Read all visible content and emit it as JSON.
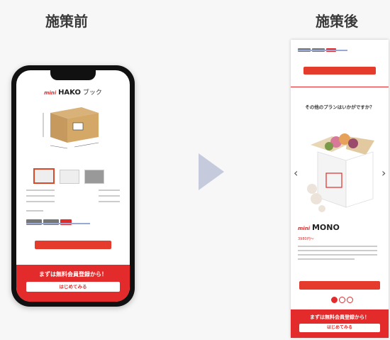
{
  "labels": {
    "before": "施策前",
    "after": "施策後"
  },
  "left_phone": {
    "brand_logo": "mini",
    "brand_sub": "HAKO",
    "brand_suffix": "ブック",
    "banner_text": "まずは無料会員登録から！",
    "banner_button": "はじめてみる"
  },
  "right_screen": {
    "question": "その他のプランはいかがですか？",
    "product_logo": "mini",
    "product_name": "MONO",
    "price": "3980円～",
    "banner_text": "まずは無料会員登録から！",
    "banner_button": "はじめてみる"
  },
  "colors": {
    "accent": "#e32b2b",
    "arrow": "#c5cbdd"
  },
  "carousel": {
    "current_index": 1,
    "total": 3
  }
}
